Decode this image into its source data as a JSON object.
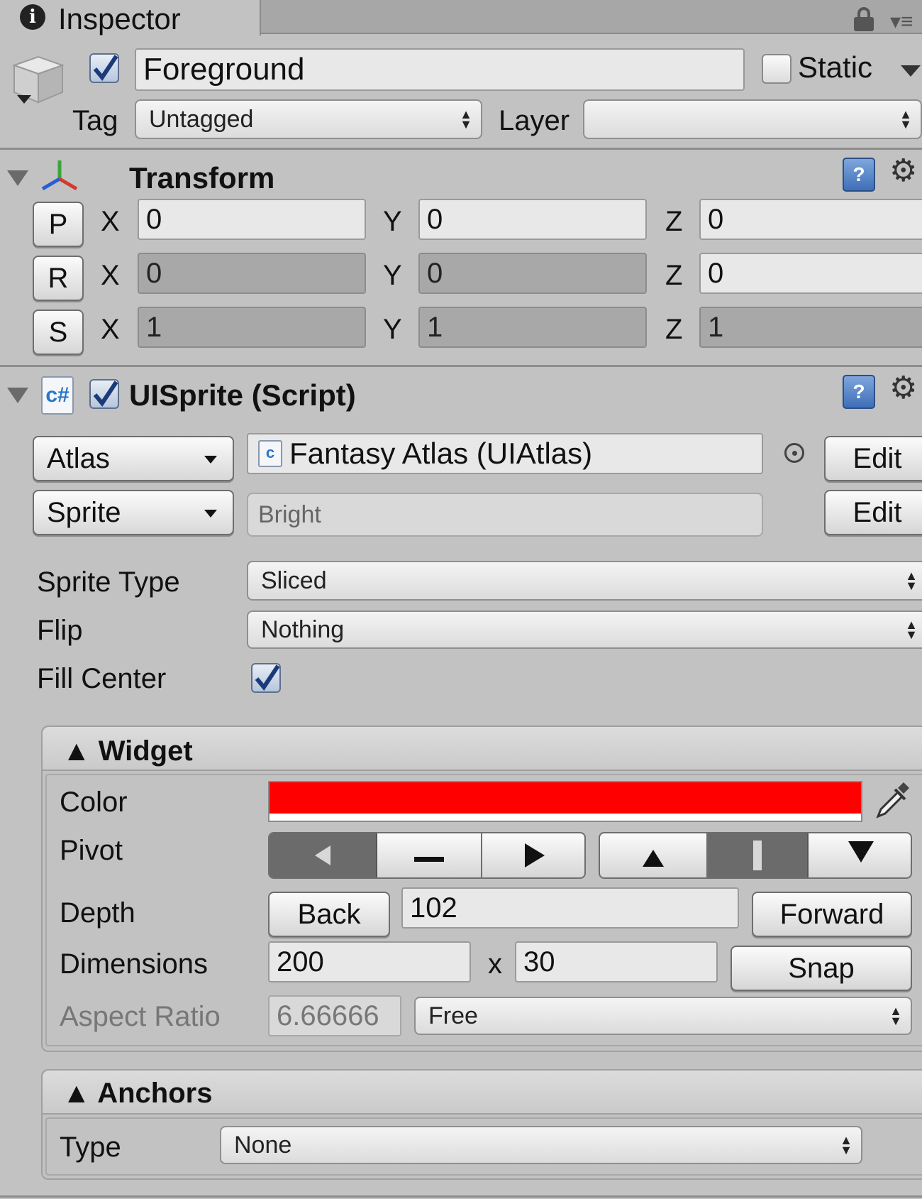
{
  "tab": {
    "title": "Inspector"
  },
  "object": {
    "name": "Foreground",
    "active": true,
    "static_label": "Static",
    "static_checked": false,
    "tag_label": "Tag",
    "tag_value": "Untagged",
    "layer_label": "Layer",
    "layer_value": ""
  },
  "transform": {
    "title": "Transform",
    "rows": [
      {
        "btn": "P",
        "x": "0",
        "y": "0",
        "z": "0"
      },
      {
        "btn": "R",
        "x": "0",
        "y": "0",
        "z": "0"
      },
      {
        "btn": "S",
        "x": "1",
        "y": "1",
        "z": "1"
      }
    ],
    "axis_x": "X",
    "axis_y": "Y",
    "axis_z": "Z"
  },
  "uisprite": {
    "title": "UISprite (Script)",
    "enabled": true,
    "atlas_label": "Atlas",
    "atlas_value": "Fantasy Atlas (UIAtlas)",
    "sprite_label": "Sprite",
    "sprite_value": "Bright",
    "edit_label": "Edit",
    "sprite_type_label": "Sprite Type",
    "sprite_type_value": "Sliced",
    "flip_label": "Flip",
    "flip_value": "Nothing",
    "fill_center_label": "Fill Center",
    "fill_center": true
  },
  "widget": {
    "title": "▲ Widget",
    "color_label": "Color",
    "color_value": "#ff0000",
    "pivot_label": "Pivot",
    "pivot_horizontal": "left",
    "pivot_vertical": "center",
    "depth_label": "Depth",
    "back_label": "Back",
    "depth_value": "102",
    "forward_label": "Forward",
    "dimensions_label": "Dimensions",
    "width": "200",
    "x_sep": "x",
    "height": "30",
    "snap_label": "Snap",
    "aspect_label": "Aspect Ratio",
    "aspect_value": "6.66666",
    "aspect_mode": "Free"
  },
  "anchors": {
    "title": "▲ Anchors",
    "type_label": "Type",
    "type_value": "None"
  }
}
